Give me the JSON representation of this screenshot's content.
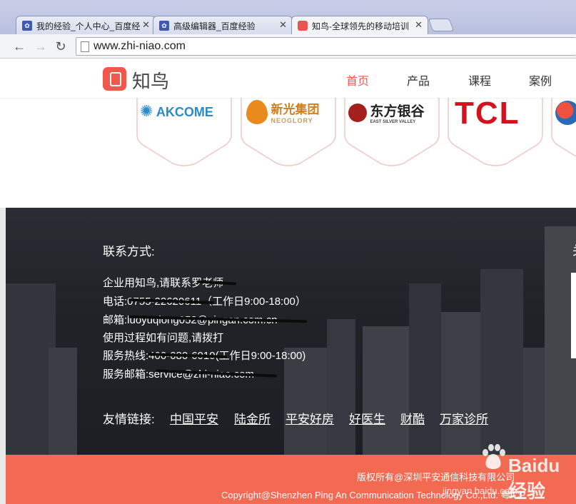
{
  "browser": {
    "tabs": [
      {
        "title": "我的经验_个人中心_百度经",
        "favicon": "baidu-paw-icon",
        "active": false
      },
      {
        "title": "高级编辑器_百度经验",
        "favicon": "baidu-paw-icon",
        "active": false
      },
      {
        "title": "知鸟-全球领先的移动培训",
        "favicon": "zhiniao-icon",
        "active": true
      }
    ],
    "url": "www.zhi-niao.com"
  },
  "site": {
    "logo_text": "知鸟",
    "nav": [
      {
        "label": "首页",
        "active": true
      },
      {
        "label": "产品",
        "active": false
      },
      {
        "label": "课程",
        "active": false
      },
      {
        "label": "案例",
        "active": false
      }
    ],
    "partners": [
      {
        "name": "AKCOME"
      },
      {
        "name": "新光集团",
        "sub": "NEOGLORY"
      },
      {
        "name": "东方银谷",
        "sub": "EAST SILVER VALLEY"
      },
      {
        "name": "TCL"
      }
    ]
  },
  "contact": {
    "title": "联系方式:",
    "lines": [
      "企业用知鸟,请联系罗老师",
      "电话:0755-22620611（工作日9:00-18:00）",
      "邮箱:luoyuqiong052@pingan.com.cn",
      "使用过程如有问题,请拨打",
      "服务热线:400-080-6010(工作日9:00-18:00)",
      "服务邮箱:service@zhi-niao.com"
    ],
    "links_label": "友情链接:",
    "links": [
      "中国平安",
      "陆金所",
      "平安好房",
      "好医生",
      "财酷",
      "万家诊所"
    ],
    "right_heading_partial": "关"
  },
  "footer": {
    "line1": "版权所有@深圳平安通信科技有限公司",
    "line2": "Copyright@Shenzhen Ping An Communication Technology Co.,Ltd. 粤ICP"
  },
  "watermark": {
    "text": "Baidu经验",
    "sub": "jingyan.baidu.com"
  },
  "colors": {
    "brand": "#f0584c",
    "footer": "#f26a52"
  }
}
